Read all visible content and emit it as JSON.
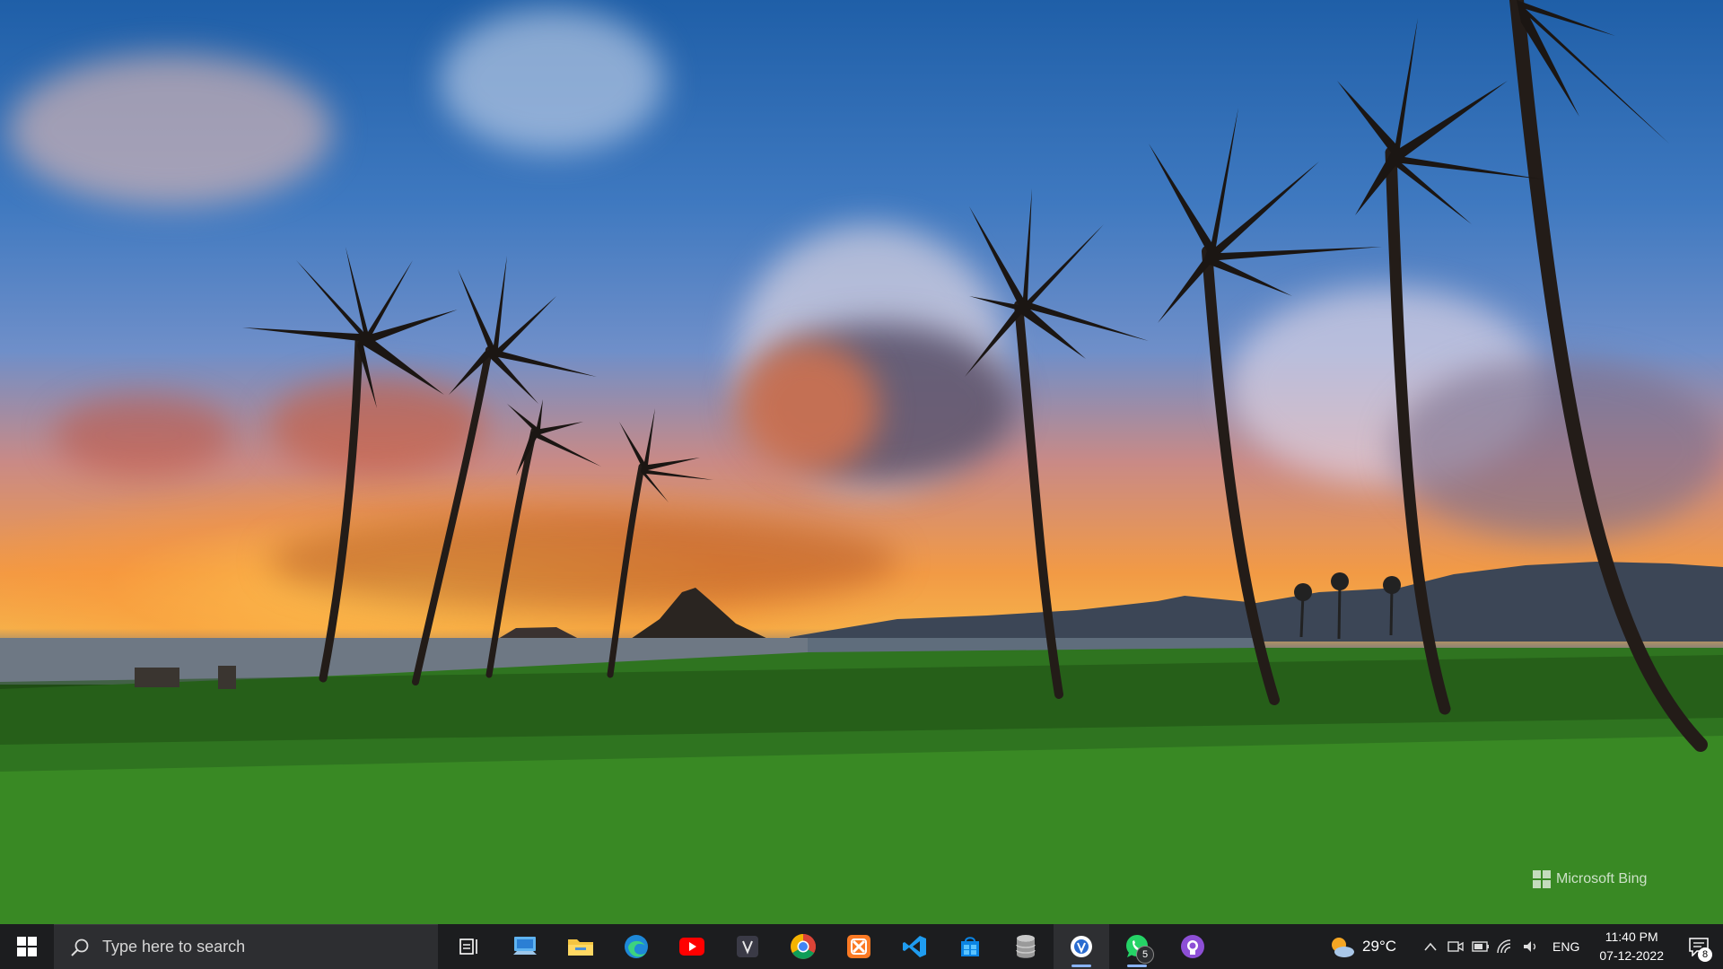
{
  "wallpaper": {
    "credit": "Microsoft Bing"
  },
  "taskbar": {
    "search": {
      "placeholder": "Type here to search"
    },
    "pinned": [
      {
        "name": "task-view-icon"
      },
      {
        "name": "this-pc-icon"
      },
      {
        "name": "file-explorer-icon"
      },
      {
        "name": "edge-icon"
      },
      {
        "name": "youtube-icon"
      },
      {
        "name": "app-store-icon"
      },
      {
        "name": "chrome-icon"
      },
      {
        "name": "xampp-icon"
      },
      {
        "name": "vscode-icon"
      },
      {
        "name": "microsoft-store-icon"
      },
      {
        "name": "database-icon"
      },
      {
        "name": "running-app-icon"
      },
      {
        "name": "whatsapp-icon",
        "badge": "5"
      },
      {
        "name": "github-desktop-icon"
      }
    ],
    "weather": {
      "temperature": "29°C"
    },
    "tray": {
      "language": "ENG"
    },
    "clock": {
      "time": "11:40 PM",
      "date": "07-12-2022"
    },
    "notifications": {
      "count": "8"
    }
  }
}
